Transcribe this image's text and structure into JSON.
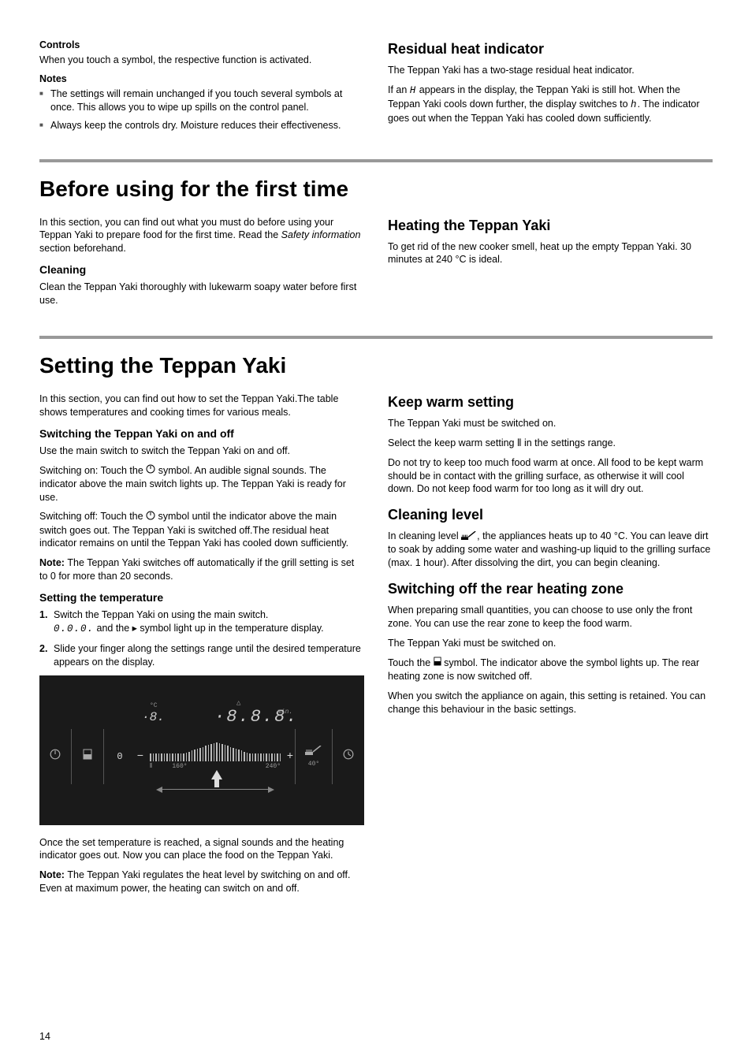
{
  "top": {
    "left": {
      "controls_heading": "Controls",
      "controls_text": "When you touch a symbol, the respective function is activated.",
      "notes_heading": "Notes",
      "notes_items": [
        "The settings will remain unchanged if you touch several symbols at once. This allows you to wipe up spills on the control panel.",
        "Always keep the controls dry. Moisture reduces their effectiveness."
      ]
    },
    "right": {
      "residual_heading": "Residual heat indicator",
      "residual_p1": "The Teppan Yaki has a two-stage residual heat indicator.",
      "residual_p2_a": "If an ",
      "residual_p2_icon1": "H",
      "residual_p2_b": " appears in the display, the Teppan Yaki is still hot. When the Teppan Yaki cools down further, the display switches to ",
      "residual_p2_icon2": "h",
      "residual_p2_c": ". The indicator goes out when the Teppan Yaki has cooled down sufficiently."
    }
  },
  "section_before": {
    "title": "Before using for the first time",
    "left": {
      "intro_a": "In this section, you can find out what you must do before using your Teppan Yaki to prepare food for the first time. Read the ",
      "intro_italic": "Safety information",
      "intro_b": " section beforehand.",
      "cleaning_heading": "Cleaning",
      "cleaning_text": "Clean the Teppan Yaki thoroughly with lukewarm soapy water before first use."
    },
    "right": {
      "heating_heading": "Heating the Teppan Yaki",
      "heating_text": "To get rid of the new cooker smell, heat up the empty Teppan Yaki. 30 minutes at 240 °C is ideal."
    }
  },
  "section_setting": {
    "title": "Setting the Teppan Yaki",
    "left": {
      "intro": "In this section, you can find out how to set the Teppan Yaki.The table shows temperatures and cooking times for various meals.",
      "switch_heading": "Switching the Teppan Yaki on and off",
      "switch_p1": "Use the main switch to switch the Teppan Yaki on and off.",
      "switch_on_a": "Switching on: Touch the ",
      "switch_on_b": " symbol. An audible signal sounds. The indicator above the main switch lights up. The Teppan Yaki is ready for use.",
      "switch_off_a": "Switching off: Touch the ",
      "switch_off_b": " symbol until the indicator above the main switch goes out. The Teppan Yaki is switched off.The residual heat indicator remains on until the Teppan Yaki has cooled down sufficiently.",
      "note_label": "Note: ",
      "note_text": "The Teppan Yaki switches off automatically if the grill setting is set to 0 for more than 20 seconds.",
      "temp_heading": "Setting the temperature",
      "step1": "Switch the Teppan Yaki on using the main switch.",
      "step1_sub_a": "",
      "step1_seg": "0.0.0.",
      "step1_sub_b": " and the ▸ symbol light up in the temperature display.",
      "step2": "Slide your finger along the settings range until the desired temperature appears on the display.",
      "after_img": "Once the set temperature is reached, a signal sounds and the heating indicator goes out. Now you can place the food on the Teppan Yaki.",
      "note2_label": "Note: ",
      "note2_text": "The Teppan Yaki regulates the heat level by switching on and off. Even at maximum power, the heating can switch on and off."
    },
    "right": {
      "keepwarm_heading": "Keep warm setting",
      "keepwarm_p1": "The Teppan Yaki must be switched on.",
      "keepwarm_p2_a": "Select the keep warm setting ",
      "keepwarm_p2_b": " in the settings range.",
      "keepwarm_p3": "Do not try to keep too much food warm at once. All food to be kept warm should be in contact with the grilling surface, as otherwise it will cool down. Do not keep food warm for too long as it will dry out.",
      "clean_heading": "Cleaning level",
      "clean_p1_a": "In cleaning level ",
      "clean_p1_b": ", the appliances heats up to 40 °C. You can leave dirt to soak by adding some water and washing-up liquid to the grilling surface (max. 1 hour). After dissolving the dirt, you can begin cleaning.",
      "rear_heading": "Switching off the rear heating zone",
      "rear_p1": "When preparing small quantities, you can choose to use only the front zone. You can use the rear zone to keep the food warm.",
      "rear_p2": "The Teppan Yaki must be switched on.",
      "rear_p3_a": "Touch the ",
      "rear_p3_b": " symbol. The indicator above the symbol lights up. The rear heating zone is now switched off.",
      "rear_p4": "When you switch the appliance on again, this setting is retained. You can change this behaviour in the basic settings."
    }
  },
  "panel": {
    "temp_unit": "°C",
    "temp_disp": "·8.",
    "timer_disp": "·8.8.8.",
    "timer_unit": "min.",
    "scale_min": "0",
    "scale_low_lbl": "160°",
    "scale_high_lbl": "240°",
    "scale_clean_lbl": "40°",
    "minus": "−",
    "plus": "+"
  },
  "page_number": "14"
}
